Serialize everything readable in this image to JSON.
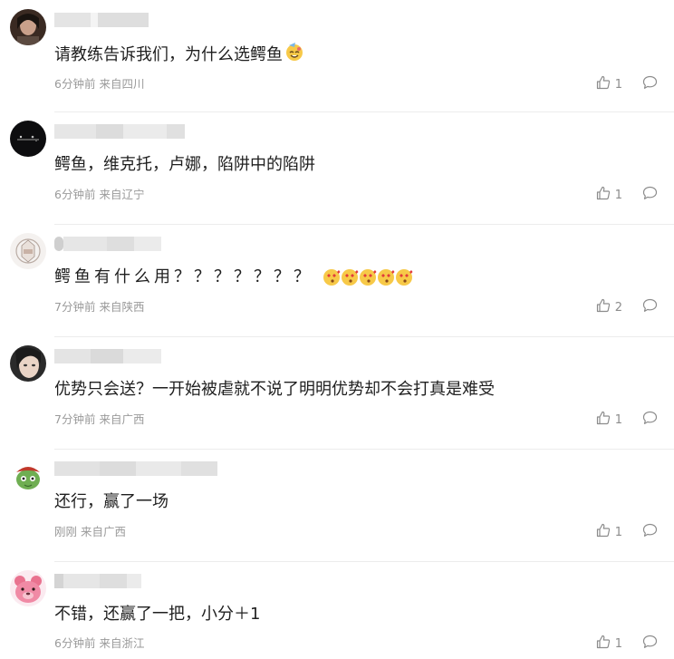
{
  "comments": [
    {
      "text": "请教练告诉我们，为什么选鳄鱼",
      "time": "6分钟前",
      "location": "来自四川",
      "likes": "1",
      "emoji": "sweat-smile-emoji"
    },
    {
      "text": "鳄鱼，维克托，卢娜，陷阱中的陷阱",
      "time": "6分钟前",
      "location": "来自辽宁",
      "likes": "1"
    },
    {
      "text": "鳄鱼有什么用？？？？？？？",
      "time": "7分钟前",
      "location": "来自陕西",
      "likes": "2",
      "emoji": "heart-eyes-kiss-emoji"
    },
    {
      "text": "优势只会送？一开始被虐就不说了明明优势却不会打真是难受",
      "time": "7分钟前",
      "location": "来自广西",
      "likes": "1"
    },
    {
      "text": "还行，赢了一场",
      "time": "刚刚",
      "location": "来自广西",
      "likes": "1"
    },
    {
      "text": "不错，还赢了一把，小分＋1",
      "time": "6分钟前",
      "location": "来自浙江",
      "likes": "1"
    }
  ],
  "colors": {
    "text": "#1f1f1f",
    "meta": "#9a9a9a",
    "icon": "#8c8c8c",
    "divider": "#ececec"
  }
}
